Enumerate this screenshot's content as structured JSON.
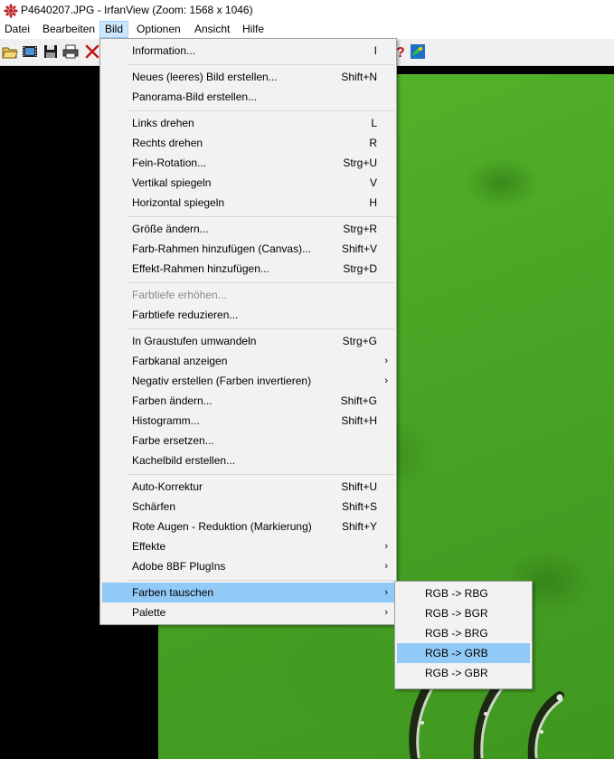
{
  "window": {
    "title": "P4640207.JPG - IrfanView (Zoom: 1568 x 1046)"
  },
  "menubar": [
    "Datei",
    "Bearbeiten",
    "Bild",
    "Optionen",
    "Ansicht",
    "Hilfe"
  ],
  "active_menu": "Bild",
  "toolbar_icons": [
    "open-folder-icon",
    "filmstrip-icon",
    "save-icon",
    "print-icon",
    "delete-icon",
    "help-icon",
    "paint-icon"
  ],
  "bild_menu": {
    "information": {
      "label": "Information...",
      "shortcut": "I"
    },
    "new_image": {
      "label": "Neues (leeres) Bild erstellen...",
      "shortcut": "Shift+N"
    },
    "panorama": {
      "label": "Panorama-Bild erstellen...",
      "shortcut": ""
    },
    "rotate_left": {
      "label": "Links drehen",
      "shortcut": "L"
    },
    "rotate_right": {
      "label": "Rechts drehen",
      "shortcut": "R"
    },
    "fine_rotation": {
      "label": "Fein-Rotation...",
      "shortcut": "Strg+U"
    },
    "flip_vertical": {
      "label": "Vertikal spiegeln",
      "shortcut": "V"
    },
    "flip_horizontal": {
      "label": "Horizontal spiegeln",
      "shortcut": "H"
    },
    "resize": {
      "label": "Größe ändern...",
      "shortcut": "Strg+R"
    },
    "add_canvas": {
      "label": "Farb-Rahmen hinzufügen (Canvas)...",
      "shortcut": "Shift+V"
    },
    "effect_border": {
      "label": "Effekt-Rahmen hinzufügen...",
      "shortcut": "Strg+D"
    },
    "increase_depth": {
      "label": "Farbtiefe erhöhen...",
      "shortcut": ""
    },
    "decrease_depth": {
      "label": "Farbtiefe reduzieren...",
      "shortcut": ""
    },
    "grayscale": {
      "label": "In Graustufen umwandeln",
      "shortcut": "Strg+G"
    },
    "show_channel": {
      "label": "Farbkanal anzeigen",
      "shortcut": ""
    },
    "negative": {
      "label": "Negativ erstellen (Farben invertieren)",
      "shortcut": ""
    },
    "change_colors": {
      "label": "Farben ändern...",
      "shortcut": "Shift+G"
    },
    "histogram": {
      "label": "Histogramm...",
      "shortcut": "Shift+H"
    },
    "replace_color": {
      "label": "Farbe ersetzen...",
      "shortcut": ""
    },
    "tile_image": {
      "label": "Kachelbild erstellen...",
      "shortcut": ""
    },
    "auto_correct": {
      "label": "Auto-Korrektur",
      "shortcut": "Shift+U"
    },
    "sharpen": {
      "label": "Schärfen",
      "shortcut": "Shift+S"
    },
    "red_eye": {
      "label": "Rote Augen - Reduktion (Markierung)",
      "shortcut": "Shift+Y"
    },
    "effects": {
      "label": "Effekte",
      "shortcut": ""
    },
    "adobe_plugins": {
      "label": "Adobe 8BF PlugIns",
      "shortcut": ""
    },
    "swap_colors": {
      "label": "Farben tauschen",
      "shortcut": ""
    },
    "palette": {
      "label": "Palette",
      "shortcut": ""
    }
  },
  "swap_submenu": [
    "RGB -> RBG",
    "RGB -> BGR",
    "RGB -> BRG",
    "RGB -> GRB",
    "RGB -> GBR"
  ],
  "colors": {
    "menu_highlight": "#91c9f7",
    "menubar_active": "#cce8ff",
    "photo_green": "#4aa425",
    "canvas_bg": "#000000"
  }
}
